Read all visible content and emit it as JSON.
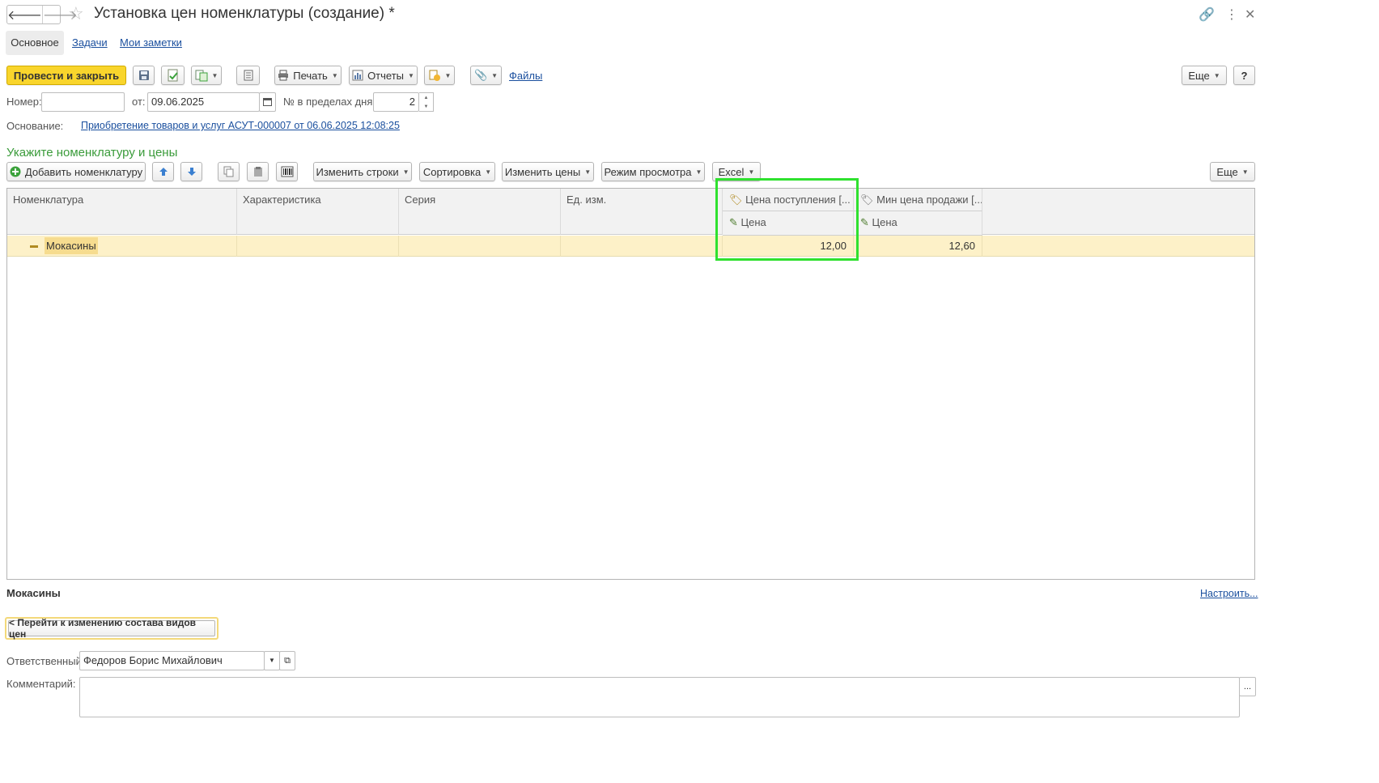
{
  "window": {
    "title": "Установка цен номенклатуры (создание) *",
    "nav_back": "🡐",
    "nav_forward": "🡒",
    "star": "☆",
    "link_icon": "🔗",
    "more_icon": "⋮",
    "close_icon": "✕"
  },
  "tabs": [
    "Основное",
    "Задачи",
    "Мои заметки"
  ],
  "toolbar": {
    "post_close": "Провести и закрыть",
    "print": "Печать",
    "reports": "Отчеты",
    "files": "Файлы",
    "more": "Еще",
    "help": "?"
  },
  "header_fields": {
    "number_label": "Номер:",
    "number_value": "",
    "date_label": "от:",
    "date_value": "09.06.2025",
    "day_num_label": "№ в пределах дня:",
    "day_num_value": "2",
    "basis_label": "Основание:",
    "basis_link": "Приобретение товаров и услуг АСУТ-000007 от 06.06.2025 12:08:25"
  },
  "section": {
    "title": "Укажите номенклатуру и цены",
    "add_item": "Добавить номенклатуру",
    "change_rows": "Изменить строки",
    "sort": "Сортировка",
    "change_prices": "Изменить цены",
    "view_mode": "Режим просмотра",
    "excel": "Excel",
    "more": "Еще"
  },
  "table": {
    "columns": [
      "Номенклатура",
      "Характеристика",
      "Серия",
      "Ед. изм."
    ],
    "price_columns": [
      {
        "title": "Цена поступления [...",
        "sub": "Цена"
      },
      {
        "title": "Мин цена продажи [...",
        "sub": "Цена"
      }
    ],
    "rows": [
      {
        "item": "Мокасины",
        "characteristic": "",
        "series": "",
        "unit": "",
        "price1": "12,00",
        "price2": "12,60"
      }
    ]
  },
  "footer": {
    "selected_name": "Мокасины",
    "configure_link": "Настроить...",
    "go_button": "< Перейти к изменению состава видов цен",
    "responsible_label": "Ответственный:",
    "responsible_value": "Федоров Борис Михайлович",
    "comment_label": "Комментарий:",
    "comment_value": "",
    "comment_more": "..."
  },
  "colors": {
    "accent_yellow": "#f9d52c",
    "section_green": "#3a9b3a",
    "row_highlight": "#fdf1c8",
    "highlight_box": "#2fe12f",
    "link": "#1a4f9e"
  }
}
